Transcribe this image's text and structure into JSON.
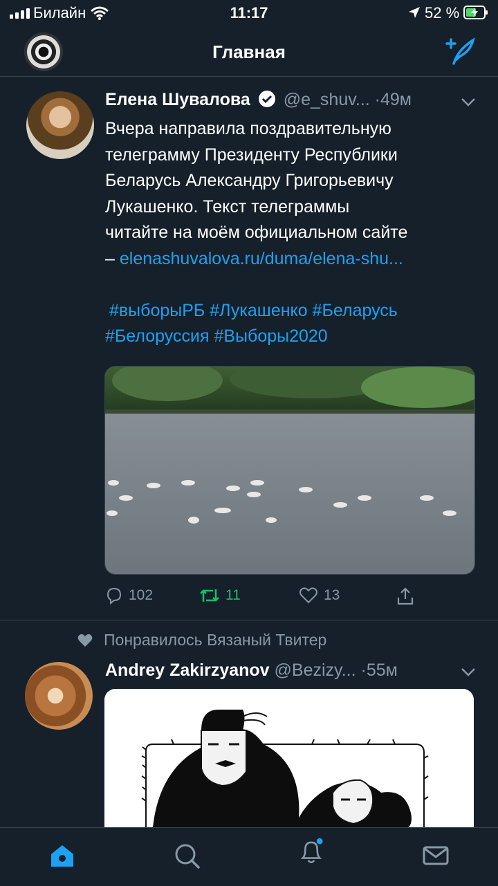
{
  "status": {
    "carrier": "Билайн",
    "time": "11:17",
    "battery": "52 %"
  },
  "header": {
    "title": "Главная"
  },
  "tweet1": {
    "name": "Елена Шувалова",
    "handle": "@e_shuv...",
    "dot": "·",
    "time": "49м",
    "text_line1": "Вчера направила поздравительную",
    "text_line2": "телеграмму Президенту Республики",
    "text_line3": "Беларусь Александру Григорьевичу",
    "text_line4": "Лукашенко. Текст телеграммы",
    "text_line5": "читайте на моём официальном сайте",
    "dash": "–",
    "link": "elenashuvalova.ru/duma/elena-shu...",
    "hashtags_line1": "#выборыРБ #Лукашенко #Беларусь",
    "hashtags_line2": "#Белоруссия #Выборы2020",
    "replies": "102",
    "retweets": "11",
    "likes": "13",
    "retweet_color": "#17bf63"
  },
  "tweet2": {
    "liked_by": "Понравилось Вязаный Твитер",
    "name": "Andrey Zakirzyanov",
    "handle": "@Bezizy...",
    "dot": "·",
    "time": "55м"
  },
  "colors": {
    "background": "#15202b",
    "accent": "#1da1f2",
    "muted": "#8899a6",
    "divider": "#38444d"
  },
  "icons": [
    "signal-icon",
    "wifi-icon",
    "location-icon",
    "battery-icon",
    "compose-tweet-icon",
    "verified-icon",
    "chevron-down-icon",
    "reply-icon",
    "retweet-icon",
    "like-icon",
    "share-icon",
    "heart-icon",
    "home-icon",
    "search-icon",
    "notifications-icon",
    "messages-icon"
  ]
}
